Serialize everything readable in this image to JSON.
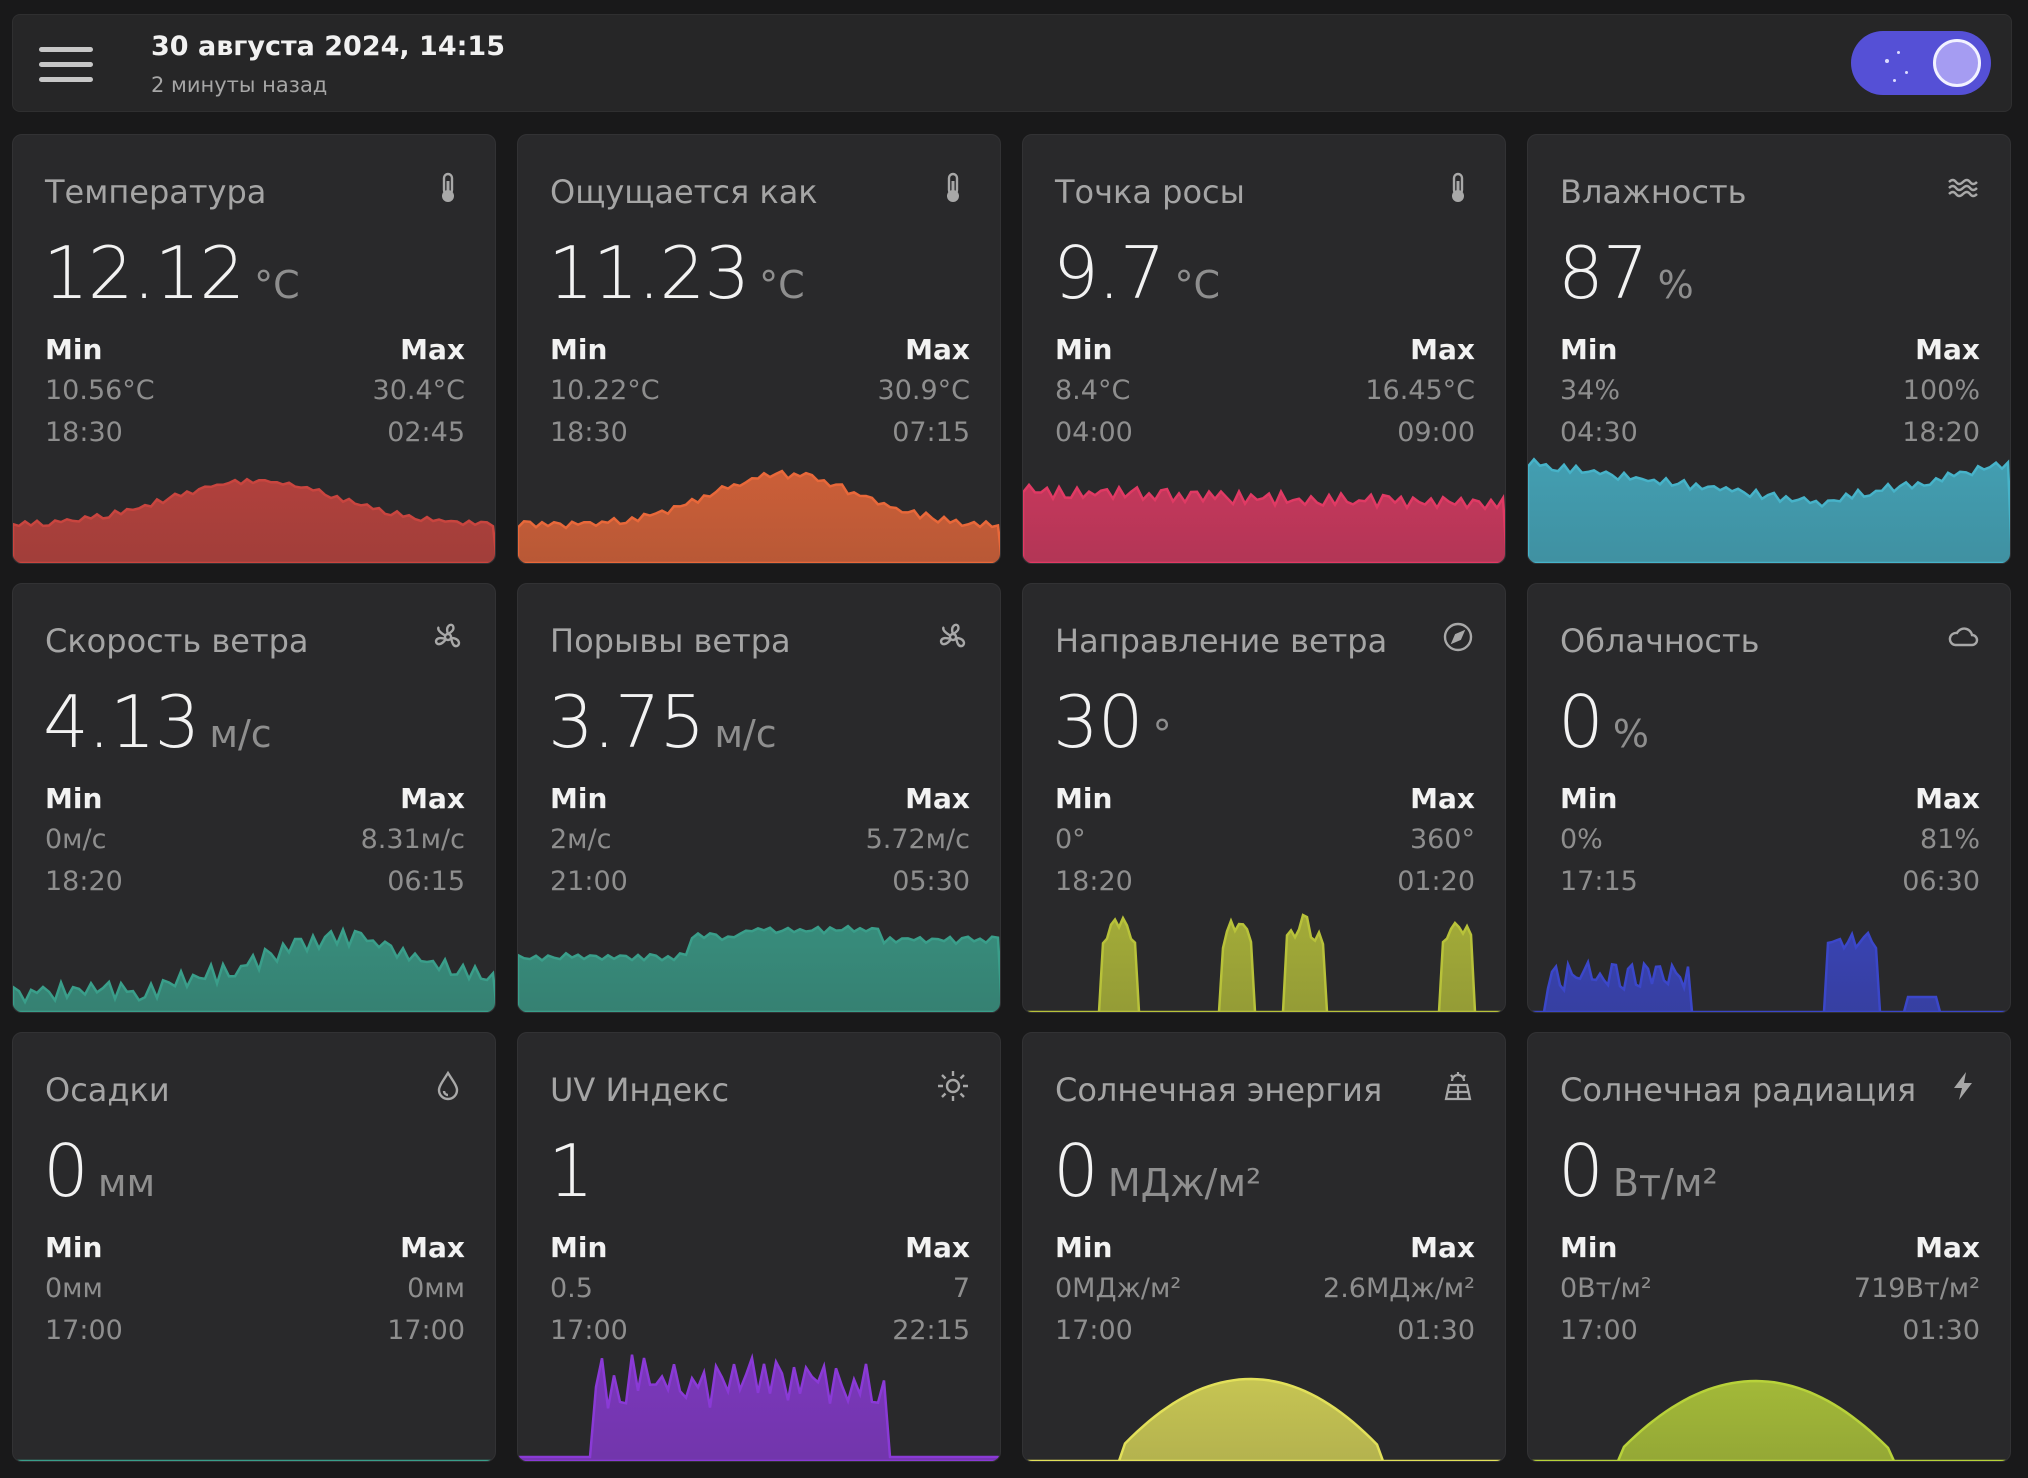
{
  "header": {
    "title": "30 августа 2024, 14:15",
    "subtitle": "2 минуты назад",
    "menu_icon": "hamburger-menu-icon",
    "theme_toggle_icon": "night-mode-toggle"
  },
  "colors": {
    "background": "#19191a",
    "card": "#29292b",
    "toggle": "#5550d6"
  },
  "cards": [
    {
      "title": "Температура",
      "icon": "thermometer-icon",
      "value": "12.12",
      "unit": "°C",
      "min_label": "Min",
      "max_label": "Max",
      "min_value": "10.56°C",
      "min_time": "18:30",
      "max_value": "30.4°C",
      "max_time": "02:45",
      "color": "#c9453f"
    },
    {
      "title": "Ощущается как",
      "icon": "thermometer-icon",
      "value": "11.23",
      "unit": "°C",
      "min_label": "Min",
      "max_label": "Max",
      "min_value": "10.22°C",
      "min_time": "18:30",
      "max_value": "30.9°C",
      "max_time": "07:15",
      "color": "#e8683a"
    },
    {
      "title": "Точка росы",
      "icon": "thermometer-icon",
      "value": "9.7",
      "unit": "°C",
      "min_label": "Min",
      "max_label": "Max",
      "min_value": "8.4°C",
      "min_time": "04:00",
      "max_value": "16.45°C",
      "max_time": "09:00",
      "color": "#e03a64"
    },
    {
      "title": "Влажность",
      "icon": "waves-icon",
      "value": "87",
      "unit": "%",
      "min_label": "Min",
      "max_label": "Max",
      "min_value": "34%",
      "min_time": "04:30",
      "max_value": "100%",
      "max_time": "18:20",
      "color": "#47b3c9"
    },
    {
      "title": "Скорость ветра",
      "icon": "wind-fan-icon",
      "value": "4.13",
      "unit": "м/с",
      "min_label": "Min",
      "max_label": "Max",
      "min_value": "0м/с",
      "min_time": "18:20",
      "max_value": "8.31м/с",
      "max_time": "06:15",
      "color": "#3a9e8a"
    },
    {
      "title": "Порывы ветра",
      "icon": "wind-fan-icon",
      "value": "3.75",
      "unit": "м/с",
      "min_label": "Min",
      "max_label": "Max",
      "min_value": "2м/с",
      "min_time": "21:00",
      "max_value": "5.72м/с",
      "max_time": "05:30",
      "color": "#3a9e8a"
    },
    {
      "title": "Направление ветра",
      "icon": "compass-icon",
      "value": "30",
      "unit": "°",
      "min_label": "Min",
      "max_label": "Max",
      "min_value": "0°",
      "min_time": "18:20",
      "max_value": "360°",
      "max_time": "01:20",
      "color": "#b8c23a"
    },
    {
      "title": "Облачность",
      "icon": "cloud-icon",
      "value": "0",
      "unit": "%",
      "min_label": "Min",
      "max_label": "Max",
      "min_value": "0%",
      "min_time": "17:15",
      "max_value": "81%",
      "max_time": "06:30",
      "color": "#3b47c9"
    },
    {
      "title": "Осадки",
      "icon": "drop-icon",
      "value": "0",
      "unit": "мм",
      "min_label": "Min",
      "max_label": "Max",
      "min_value": "0мм",
      "min_time": "17:00",
      "max_value": "0мм",
      "max_time": "17:00",
      "color": "#3a9e8a"
    },
    {
      "title": "UV Индекс",
      "icon": "sun-icon",
      "value": "1",
      "unit": "",
      "min_label": "Min",
      "max_label": "Max",
      "min_value": "0.5",
      "min_time": "17:00",
      "max_value": "7",
      "max_time": "22:15",
      "color": "#8a3ad6"
    },
    {
      "title": "Солнечная энергия",
      "icon": "solar-panel-icon",
      "value": "0",
      "unit": "МДж/м²",
      "min_label": "Min",
      "max_label": "Max",
      "min_value": "0МДж/м²",
      "min_time": "17:00",
      "max_value": "2.6МДж/м²",
      "max_time": "01:30",
      "color": "#e2e05a"
    },
    {
      "title": "Солнечная радиация",
      "icon": "lightning-icon",
      "value": "0",
      "unit": "Вт/м²",
      "min_label": "Min",
      "max_label": "Max",
      "min_value": "0Вт/м²",
      "min_time": "17:00",
      "max_value": "719Вт/м²",
      "max_time": "01:30",
      "color": "#b8d23a"
    }
  ]
}
